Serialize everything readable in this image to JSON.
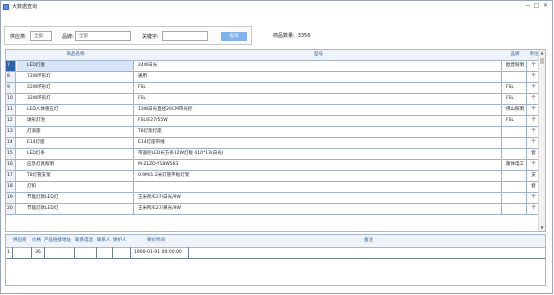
{
  "window": {
    "title": "大数据查询",
    "min": "—",
    "max": "□",
    "close": "✕"
  },
  "filters": {
    "category_label": "供应类:",
    "category_value": "全部",
    "brand_label": "品牌:",
    "brand_value": "全部",
    "keyword_label": "关键字:",
    "keyword_value": "",
    "query_button": "查询"
  },
  "count": {
    "label": "商品数量:",
    "value": "3356"
  },
  "grid": {
    "columns": [
      "商品名称",
      "型号",
      "品牌",
      "单位"
    ],
    "rows": [
      {
        "num": "7",
        "name": "LED灯盘",
        "model": "24W白光",
        "brand": "欧普照明",
        "unit": "个"
      },
      {
        "num": "8",
        "name": "72W环形灯",
        "model": "通用",
        "brand": "",
        "unit": "个"
      },
      {
        "num": "9",
        "name": "22W环形灯",
        "model": "FSL",
        "brand": "FSL",
        "unit": "个"
      },
      {
        "num": "10",
        "name": "32W环形灯",
        "model": "FSL",
        "brand": "FSL",
        "unit": "个"
      },
      {
        "num": "11",
        "name": "LED人体感应灯",
        "model": "13W白光直径26CM带光控",
        "brand": "佛山照明",
        "unit": "个"
      },
      {
        "num": "12",
        "name": "球形灯泡",
        "model": "FSL/E27/55W",
        "brand": "FSL",
        "unit": "个"
      },
      {
        "num": "13",
        "name": "灯滚座",
        "model": "T8灯架灯座",
        "brand": "",
        "unit": "个"
      },
      {
        "num": "14",
        "name": "E14灯座",
        "model": "E14灯座带线",
        "brand": "",
        "unit": "个"
      },
      {
        "num": "15",
        "name": "LED灯条",
        "model": "带遥控LED长方条12W灯板 410*13(白光)",
        "brand": "",
        "unit": "套"
      },
      {
        "num": "16",
        "name": "应急灯具照明",
        "model": "M-ZLZD-Y18W563",
        "brand": "敬体电工",
        "unit": "个"
      },
      {
        "num": "17",
        "name": "T8灯管支架",
        "model": "0.9M/1.2米灯管平板灯架",
        "brand": "",
        "unit": "支"
      },
      {
        "num": "18",
        "name": "灯扣",
        "model": "",
        "brand": "",
        "unit": "套"
      },
      {
        "num": "19",
        "name": "节能灯款LED灯",
        "model": "王米所/E27/白光/9W",
        "brand": "",
        "unit": "个"
      },
      {
        "num": "20",
        "name": "节能灯款LED灯",
        "model": "王米所/E27/黄光/9W",
        "brand": "",
        "unit": "个"
      }
    ],
    "scroll_up": "▲",
    "scroll_down": "▼"
  },
  "detail": {
    "columns": [
      "供应商",
      "价格",
      "产品链接地址",
      "联系电话",
      "联系人",
      "保护人",
      "保价时间",
      "备注"
    ],
    "rows": [
      {
        "num": "1",
        "supplier": "",
        "price": "36",
        "link": "",
        "phone": "",
        "contact": "",
        "protector": "",
        "time": "1900-01-01 00:00:00",
        "note": ""
      }
    ]
  }
}
